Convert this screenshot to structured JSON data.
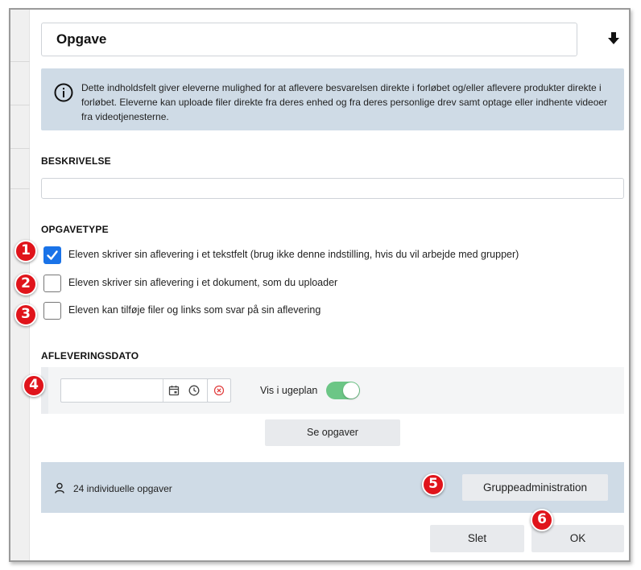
{
  "dialog": {
    "title": "Opgave",
    "info_text": "Dette indholdsfelt giver eleverne mulighed for at aflevere besvarelsen direkte i forløbet og/eller aflevere produkter direkte i forløbet. Eleverne kan uploade filer direkte fra deres enhed og fra deres personlige drev samt optage eller indhente videoer fra videotjenesterne.",
    "description": {
      "label": "BESKRIVELSE",
      "value": ""
    },
    "task_type": {
      "label": "OPGAVETYPE",
      "options": [
        {
          "label": "Eleven skriver sin aflevering i et tekstfelt (brug ikke denne indstilling, hvis du vil arbejde med grupper)",
          "checked": true
        },
        {
          "label": "Eleven skriver sin aflevering i et dokument, som du uploader",
          "checked": false
        },
        {
          "label": "Eleven kan tilføje filer og links som svar på sin aflevering",
          "checked": false
        }
      ]
    },
    "due_date": {
      "label": "AFLEVERINGSDATO",
      "value": "",
      "show_in_weekplan_label": "Vis i ugeplan",
      "show_in_weekplan": true
    },
    "see_tasks_label": "Se opgaver",
    "group": {
      "count_text": "24 individuelle opgaver",
      "admin_button_label": "Gruppeadministration"
    },
    "delete_label": "Slet",
    "ok_label": "OK"
  },
  "badges": [
    "1",
    "2",
    "3",
    "4",
    "5",
    "6"
  ],
  "colors": {
    "accent": "#1a73e8",
    "toggle_on": "#6cc686",
    "info_bg": "#cfdbe6",
    "badge": "#e0141b"
  },
  "icons": [
    "download-icon",
    "info-icon",
    "calendar-icon",
    "clock-icon",
    "clear-icon",
    "person-icon",
    "check-icon"
  ]
}
